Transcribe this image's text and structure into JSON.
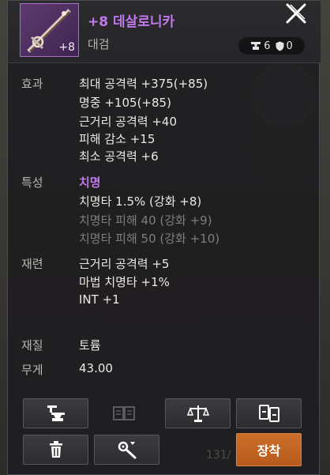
{
  "item": {
    "name": "+8 데살로니카",
    "type": "대검",
    "icon_badge": "+8",
    "counts": {
      "anvil": "6",
      "shield": "0"
    }
  },
  "stats": {
    "effect_label": "효과",
    "effects": [
      "최대 공격력 +375(+85)",
      "명중 +105(+85)",
      "근거리 공격력 +40",
      "피해 감소 +15",
      "최소 공격력 +6"
    ],
    "trait_label": "특성",
    "trait_name": "치명",
    "traits": [
      {
        "text": "치명타 1.5% (강화 +8)",
        "active": true
      },
      {
        "text": "치명타 피해 40 (강화 +9)",
        "active": false
      },
      {
        "text": "치명타 피해 50 (강화 +10)",
        "active": false
      }
    ],
    "refine_label": "재련",
    "refines": [
      "근거리 공격력 +5",
      "마법 치명타 +1%",
      "INT +1"
    ],
    "material_label": "재질",
    "material_value": "토륨",
    "weight_label": "무게",
    "weight_value": "43.00"
  },
  "buttons": {
    "equip_label": "장착",
    "ghost_count": "131/"
  },
  "colors": {
    "item_name": "#c278ef",
    "equip_button": "#c4662a"
  },
  "icons": {
    "close": "close-x-icon",
    "anvil": "anvil-icon",
    "shield": "shield-icon",
    "trash": "trash-icon",
    "wrench": "wrench-icon",
    "scale": "scale-icon",
    "compare": "compare-icon",
    "book": "book-icon"
  }
}
